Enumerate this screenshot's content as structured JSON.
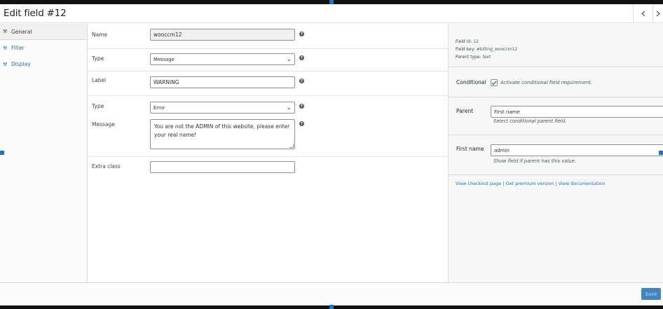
{
  "header": {
    "title": "Edit field #12",
    "prev_icon": "chevron-left-icon",
    "next_icon": "chevron-right-icon"
  },
  "sidebar": {
    "tabs": [
      {
        "label": "General",
        "icon": "wrench-icon",
        "active": true
      },
      {
        "label": "Filter",
        "icon": "wrench-icon",
        "active": false
      },
      {
        "label": "Display",
        "icon": "wrench-icon",
        "active": false
      }
    ]
  },
  "main": {
    "name": {
      "label": "Name",
      "value": "wooccm12"
    },
    "type1": {
      "label": "Type",
      "value": "Message"
    },
    "label_field": {
      "label": "Label",
      "value": "WARNING"
    },
    "type2": {
      "label": "Type",
      "value": "Error"
    },
    "message": {
      "label": "Message",
      "value": "You are not the ADMIN of this website, please enter your real name!"
    },
    "extra_class": {
      "label": "Extra class",
      "value": ""
    }
  },
  "right": {
    "field_id_label": "Field id:",
    "field_id": "12",
    "field_key_label": "Field key:",
    "field_key": "#billing_wooccm12",
    "parent_type_label": "Parent type:",
    "parent_type": "text",
    "conditional": {
      "label": "Conditional",
      "desc": "Activate conditional field requirement.",
      "checked": true
    },
    "parent": {
      "label": "Parent",
      "value": "First name",
      "desc": "Select conditional parent field."
    },
    "first_name": {
      "label": "First name",
      "value": "admin",
      "desc": "Show field if parent has this value."
    },
    "links": {
      "checkout": "View checkout page",
      "sep1": " | ",
      "premium": "Get premium version",
      "sep2": " | ",
      "docs": "View documentation"
    }
  },
  "footer": {
    "save_label": "Save"
  },
  "colors": {
    "accent": "#2271b1",
    "border": "#dcdcde",
    "panel": "#f6f7f7"
  }
}
